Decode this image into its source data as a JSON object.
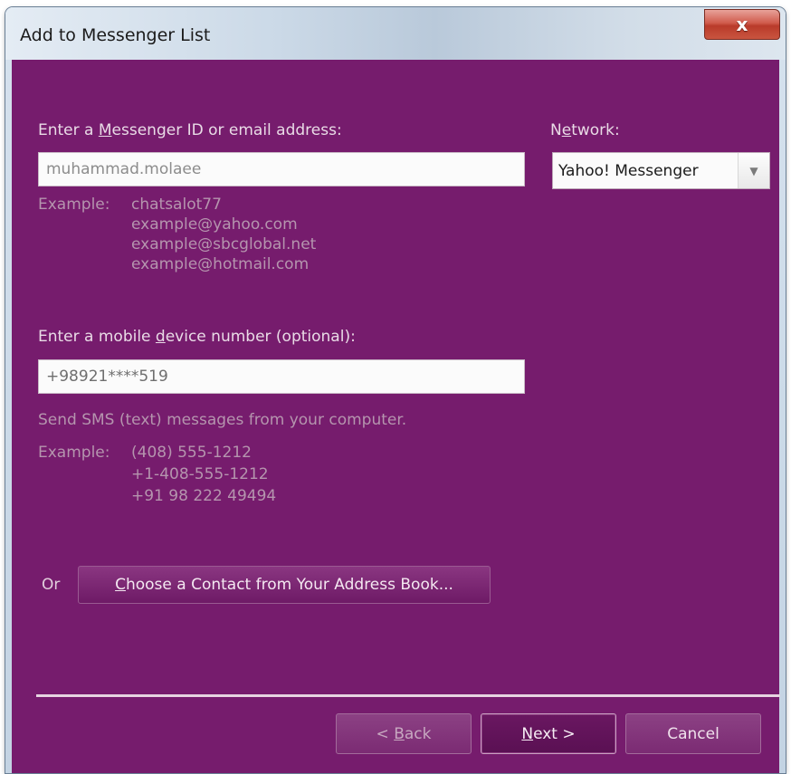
{
  "window": {
    "title": "Add to Messenger List",
    "close_glyph": "x"
  },
  "id_section": {
    "label_pre": "Enter a ",
    "label_underlined": "M",
    "label_post": "essenger ID or email address:",
    "value": "muhammad.molaee",
    "example_label": "Example:",
    "examples": [
      "chatsalot77",
      "example@yahoo.com",
      "example@sbcglobal.net",
      "example@hotmail.com"
    ]
  },
  "network": {
    "label_pre": "N",
    "label_underlined": "e",
    "label_post": "twork:",
    "selected": "Yahoo! Messenger",
    "arrow_icon": "chevron-down-icon"
  },
  "mobile_section": {
    "label_pre": "Enter a mobile ",
    "label_underlined": "d",
    "label_post": "evice number (optional):",
    "value": "+98921****519",
    "hint": "Send SMS (text) messages from your computer.",
    "example_label": "Example:",
    "examples": [
      "(408) 555-1212",
      "+1-408-555-1212",
      "+91 98 222 49494"
    ]
  },
  "address_book": {
    "or_label": "Or",
    "button_underlined": "C",
    "button_rest": "hoose a Contact from Your Address Book..."
  },
  "footer": {
    "back_prefix": "< ",
    "back_underlined": "B",
    "back_rest": "ack",
    "next_underlined": "N",
    "next_rest": "ext >",
    "cancel": "Cancel"
  },
  "colors": {
    "client_bg": "#761c6d",
    "label_text": "#e9dbe6",
    "hint_text": "#b595ae"
  }
}
